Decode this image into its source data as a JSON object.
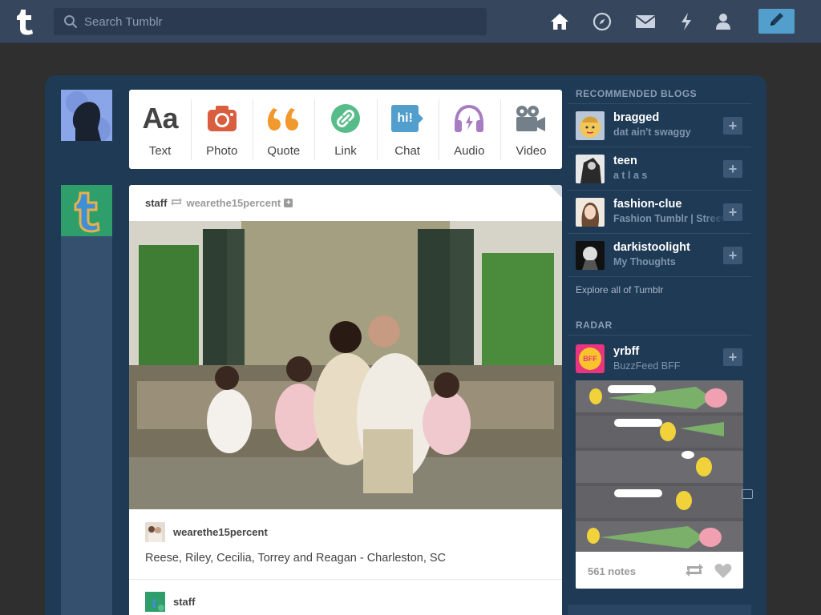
{
  "search": {
    "placeholder": "Search Tumblr"
  },
  "nav": {
    "icons": [
      "home-icon",
      "explore-compass-icon",
      "messages-envelope-icon",
      "activity-lightning-icon",
      "account-person-icon"
    ],
    "compose_icon": "pencil-icon"
  },
  "post_types": [
    {
      "label": "Text",
      "glyph": "Aa",
      "color": "#444444"
    },
    {
      "label": "Photo",
      "color": "#d95e40"
    },
    {
      "label": "Quote",
      "glyph": "66",
      "color": "#f2992e"
    },
    {
      "label": "Link",
      "color": "#56bc8a"
    },
    {
      "label": "Chat",
      "glyph": "hi!",
      "color": "#529ecc"
    },
    {
      "label": "Audio",
      "color": "#a77dc2"
    },
    {
      "label": "Video",
      "color": "#748089"
    }
  ],
  "post": {
    "author": "staff",
    "reblogged_from": "wearethe15percent",
    "reblog_user": "wearethe15percent",
    "caption": "Reese, Riley, Cecilia, Torrey and Reagan - Charleston, SC",
    "next_reblogger": "staff"
  },
  "sidebar": {
    "recommended_heading": "RECOMMENDED BLOGS",
    "blogs": [
      {
        "name": "bragged",
        "tagline": "dat ain't swaggy"
      },
      {
        "name": "teen",
        "tagline": "a t l a s"
      },
      {
        "name": "fashion-clue",
        "tagline": "Fashion Tumblr | Street"
      },
      {
        "name": "darkistoolight",
        "tagline": "My Thoughts"
      }
    ],
    "explore_link": "Explore all of Tumblr",
    "radar_heading": "RADAR",
    "radar": {
      "name": "yrbff",
      "tagline": "BuzzFeed BFF",
      "notes": "561 notes",
      "avatar_text": "BFF"
    }
  },
  "colors": {
    "topbar": "#36465d",
    "panel": "#1f3a55",
    "accent": "#529ecc",
    "page_bg": "#2f2f2f"
  }
}
